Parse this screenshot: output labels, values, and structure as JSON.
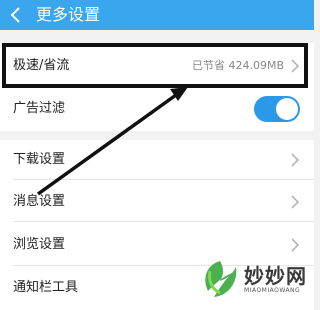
{
  "header": {
    "title": "更多设置",
    "back_icon": "chevron-left-icon",
    "bg_color": "#3aa6ee"
  },
  "settings": {
    "speed_saver": {
      "label": "极速/省流",
      "value": "已节省 424.09MB"
    },
    "ad_filter": {
      "label": "广告过滤",
      "enabled": true
    },
    "download": {
      "label": "下载设置"
    },
    "message": {
      "label": "消息设置"
    },
    "browse": {
      "label": "浏览设置"
    },
    "notification_bar": {
      "label": "通知栏工具"
    }
  },
  "accent_color": "#2a99e8",
  "watermark": {
    "title": "妙妙网",
    "subtitle": "MIAOMIAOWANG"
  }
}
